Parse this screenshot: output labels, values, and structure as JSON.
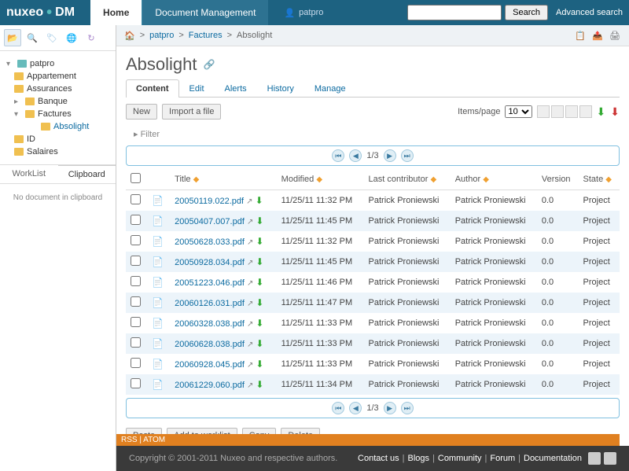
{
  "header": {
    "brand1": "nuxeo",
    "brand2": "DM",
    "tabs": [
      {
        "label": "Home",
        "active": true
      },
      {
        "label": "Document Management"
      }
    ],
    "user": "patpro",
    "search_btn": "Search",
    "adv_search": "Advanced search"
  },
  "tree": {
    "root": "patpro",
    "items": [
      "Appartement",
      "Assurances",
      "Banque",
      "Factures",
      "ID",
      "Salaires"
    ],
    "factures_child": "Absolight"
  },
  "side_bottom": {
    "tab1": "WorkList",
    "tab2": "Clipboard",
    "empty": "No document in clipboard"
  },
  "breadcrumb": {
    "p1": "patpro",
    "p2": "Factures",
    "p3": "Absolight"
  },
  "title": "Absolight",
  "content_tabs": [
    "Content",
    "Edit",
    "Alerts",
    "History",
    "Manage"
  ],
  "action_bar": {
    "new": "New",
    "import": "Import a file",
    "items_page": "Items/page",
    "items_page_val": "10"
  },
  "filter": "Filter",
  "pager": "1/3",
  "columns": {
    "title": "Title",
    "modified": "Modified",
    "contributor": "Last contributor",
    "author": "Author",
    "version": "Version",
    "state": "State"
  },
  "rows": [
    {
      "name": "20050119.022.pdf",
      "modified": "11/25/11 11:32 PM",
      "contrib": "Patrick Proniewski",
      "author": "Patrick Proniewski",
      "version": "0.0",
      "state": "Project"
    },
    {
      "name": "20050407.007.pdf",
      "modified": "11/25/11 11:45 PM",
      "contrib": "Patrick Proniewski",
      "author": "Patrick Proniewski",
      "version": "0.0",
      "state": "Project"
    },
    {
      "name": "20050628.033.pdf",
      "modified": "11/25/11 11:32 PM",
      "contrib": "Patrick Proniewski",
      "author": "Patrick Proniewski",
      "version": "0.0",
      "state": "Project"
    },
    {
      "name": "20050928.034.pdf",
      "modified": "11/25/11 11:45 PM",
      "contrib": "Patrick Proniewski",
      "author": "Patrick Proniewski",
      "version": "0.0",
      "state": "Project"
    },
    {
      "name": "20051223.046.pdf",
      "modified": "11/25/11 11:46 PM",
      "contrib": "Patrick Proniewski",
      "author": "Patrick Proniewski",
      "version": "0.0",
      "state": "Project"
    },
    {
      "name": "20060126.031.pdf",
      "modified": "11/25/11 11:47 PM",
      "contrib": "Patrick Proniewski",
      "author": "Patrick Proniewski",
      "version": "0.0",
      "state": "Project"
    },
    {
      "name": "20060328.038.pdf",
      "modified": "11/25/11 11:33 PM",
      "contrib": "Patrick Proniewski",
      "author": "Patrick Proniewski",
      "version": "0.0",
      "state": "Project"
    },
    {
      "name": "20060628.038.pdf",
      "modified": "11/25/11 11:33 PM",
      "contrib": "Patrick Proniewski",
      "author": "Patrick Proniewski",
      "version": "0.0",
      "state": "Project"
    },
    {
      "name": "20060928.045.pdf",
      "modified": "11/25/11 11:33 PM",
      "contrib": "Patrick Proniewski",
      "author": "Patrick Proniewski",
      "version": "0.0",
      "state": "Project"
    },
    {
      "name": "20061229.060.pdf",
      "modified": "11/25/11 11:34 PM",
      "contrib": "Patrick Proniewski",
      "author": "Patrick Proniewski",
      "version": "0.0",
      "state": "Project"
    }
  ],
  "bottom_btns": {
    "paste": "Paste",
    "worklist": "Add to worklist",
    "copy": "Copy",
    "delete": "Delete"
  },
  "rss": "RSS | ATOM",
  "footer": {
    "copyright": "Copyright © 2001-2011 Nuxeo and respective authors.",
    "links": [
      "Contact us",
      "Blogs",
      "Community",
      "Forum",
      "Documentation"
    ]
  }
}
